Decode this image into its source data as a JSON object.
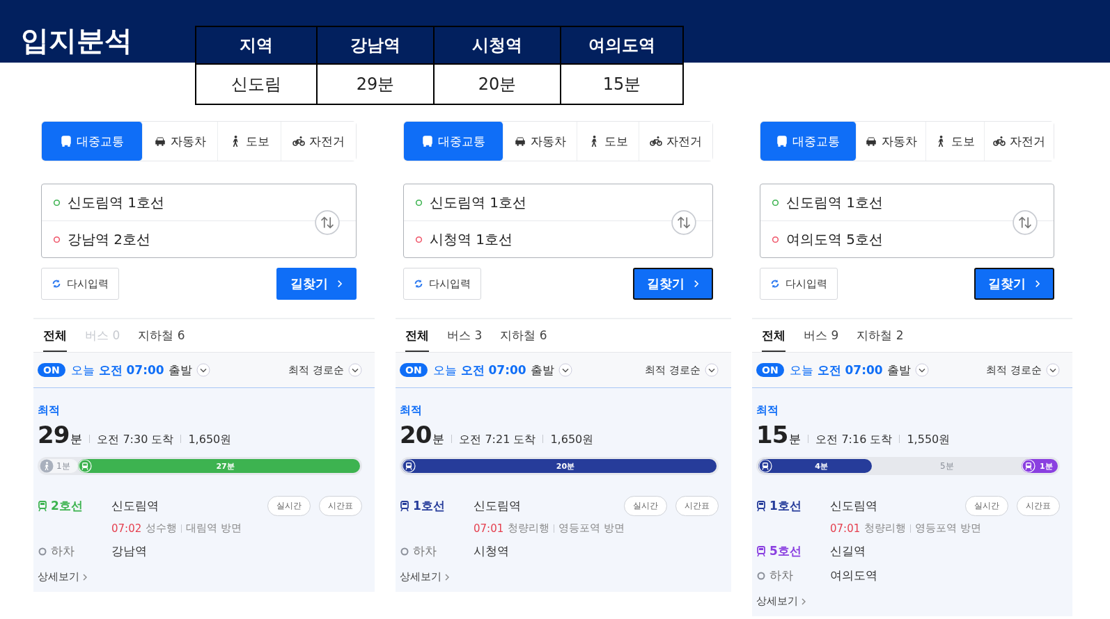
{
  "header": {
    "title": "입지분석",
    "table": {
      "columns": [
        "지역",
        "강남역",
        "시청역",
        "여의도역"
      ],
      "rows": [
        [
          "신도림",
          "29분",
          "20분",
          "15분"
        ]
      ]
    }
  },
  "panels": [
    {
      "modes": [
        {
          "kind": "transit",
          "label": "대중교통",
          "selected": true
        },
        {
          "kind": "car",
          "label": "자동차",
          "selected": false
        },
        {
          "kind": "walk",
          "label": "도보",
          "selected": false
        },
        {
          "kind": "bike",
          "label": "자전거",
          "selected": false
        }
      ],
      "origin": "신도림역 1호선",
      "destination": "강남역 2호선",
      "reset_button": "다시입력",
      "search_button": {
        "label": "길찾기",
        "focused": false
      },
      "result_tabs": [
        {
          "label": "전체",
          "selected": true,
          "disabled": false
        },
        {
          "label": "버스 0",
          "selected": false,
          "disabled": true
        },
        {
          "label": "지하철 6",
          "selected": false,
          "disabled": false
        }
      ],
      "departure": {
        "toggle": "ON",
        "day": "오늘",
        "time": "오전 07:00",
        "suffix": "출발"
      },
      "sort": "최적 경로순",
      "result": {
        "badge": "최적",
        "duration": "29",
        "duration_unit": "분",
        "arrival": "오전 7:30 도착",
        "fare": "1,650원",
        "segments": [
          {
            "kind": "walk",
            "label": "1분",
            "level": 0.12,
            "color": "#a9b0bd"
          },
          {
            "kind": "subway",
            "label": "27분",
            "level": 0.88,
            "color": "#3db350"
          }
        ],
        "steps": [
          {
            "kind": "board",
            "line": "2호선",
            "color": "#3db350",
            "station": "신도림역",
            "buttons": [
              "실시간",
              "시간표"
            ],
            "detail": {
              "time": "07:02",
              "text": "성수행",
              "direction": "대림역 방면"
            }
          },
          {
            "kind": "alight",
            "line": "하차",
            "station": "강남역"
          }
        ],
        "detail_link": "상세보기"
      }
    },
    {
      "modes": [
        {
          "kind": "transit",
          "label": "대중교통",
          "selected": true
        },
        {
          "kind": "car",
          "label": "자동차",
          "selected": false
        },
        {
          "kind": "walk",
          "label": "도보",
          "selected": false
        },
        {
          "kind": "bike",
          "label": "자전거",
          "selected": false
        }
      ],
      "origin": "신도림역 1호선",
      "destination": "시청역 1호선",
      "reset_button": "다시입력",
      "search_button": {
        "label": "길찾기",
        "focused": true
      },
      "result_tabs": [
        {
          "label": "전체",
          "selected": true,
          "disabled": false
        },
        {
          "label": "버스 3",
          "selected": false,
          "disabled": false
        },
        {
          "label": "지하철 6",
          "selected": false,
          "disabled": false
        }
      ],
      "departure": {
        "toggle": "ON",
        "day": "오늘",
        "time": "오전 07:00",
        "suffix": "출발"
      },
      "sort": "최적 경로순",
      "result": {
        "badge": "최적",
        "duration": "20",
        "duration_unit": "분",
        "arrival": "오전 7:21 도착",
        "fare": "1,650원",
        "segments": [
          {
            "kind": "subway",
            "label": "20분",
            "level": 1,
            "color": "#263c9a"
          }
        ],
        "steps": [
          {
            "kind": "board",
            "line": "1호선",
            "color": "#263c9a",
            "station": "신도림역",
            "buttons": [
              "실시간",
              "시간표"
            ],
            "detail": {
              "time": "07:01",
              "text": "청량리행",
              "direction": "영등포역 방면"
            }
          },
          {
            "kind": "alight",
            "line": "하차",
            "station": "시청역"
          }
        ],
        "detail_link": "상세보기"
      }
    },
    {
      "modes": [
        {
          "kind": "transit",
          "label": "대중교통",
          "selected": true
        },
        {
          "kind": "car",
          "label": "자동차",
          "selected": false
        },
        {
          "kind": "walk",
          "label": "도보",
          "selected": false
        },
        {
          "kind": "bike",
          "label": "자전거",
          "selected": false
        }
      ],
      "origin": "신도림역 1호선",
      "destination": "여의도역 5호선",
      "reset_button": "다시입력",
      "search_button": {
        "label": "길찾기",
        "focused": true
      },
      "result_tabs": [
        {
          "label": "전체",
          "selected": true,
          "disabled": false
        },
        {
          "label": "버스 9",
          "selected": false,
          "disabled": false
        },
        {
          "label": "지하철 2",
          "selected": false,
          "disabled": false
        }
      ],
      "departure": {
        "toggle": "ON",
        "day": "오늘",
        "time": "오전 07:00",
        "suffix": "출발"
      },
      "sort": "최적 경로순",
      "result": {
        "badge": "최적",
        "duration": "15",
        "duration_unit": "분",
        "arrival": "오전 7:16 도착",
        "fare": "1,550원",
        "segments": [
          {
            "kind": "subway",
            "label": "4분",
            "level": 0.38,
            "color": "#263c9a"
          },
          {
            "kind": "transfer",
            "label": "5분"
          },
          {
            "kind": "subway",
            "label": "1분",
            "level": 0.12,
            "color": "#8a3fe0"
          }
        ],
        "steps": [
          {
            "kind": "board",
            "line": "1호선",
            "color": "#263c9a",
            "station": "신도림역",
            "buttons": [
              "실시간",
              "시간표"
            ],
            "detail": {
              "time": "07:01",
              "text": "청량리행",
              "direction": "영등포역 방면"
            }
          },
          {
            "kind": "board",
            "line": "5호선",
            "color": "#8a3fe0",
            "station": "신길역"
          },
          {
            "kind": "alight",
            "line": "하차",
            "station": "여의도역"
          }
        ],
        "detail_link": "상세보기"
      }
    }
  ]
}
